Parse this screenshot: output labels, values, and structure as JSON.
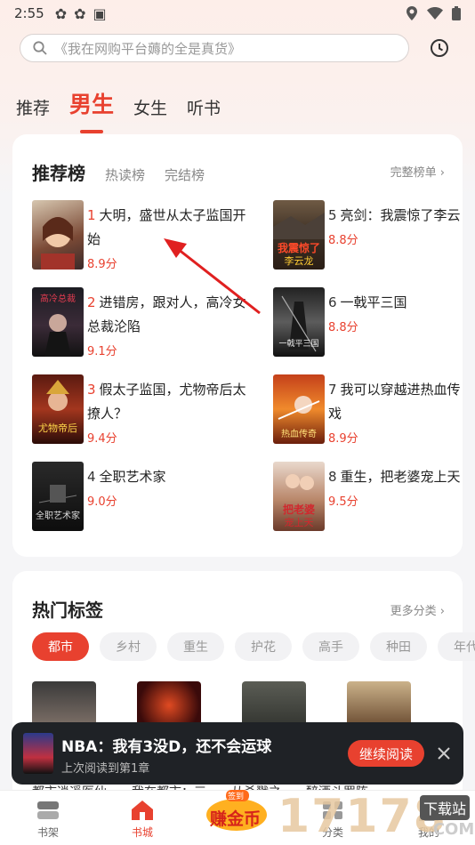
{
  "status_bar": {
    "time": "2:55"
  },
  "search": {
    "placeholder": "《我在网购平台薅的全是真货》"
  },
  "channel_tabs": [
    {
      "label": "推荐",
      "active": false
    },
    {
      "label": "男生",
      "active": true
    },
    {
      "label": "女生",
      "active": false
    },
    {
      "label": "听书",
      "active": false
    }
  ],
  "ranking": {
    "tabs": [
      "推荐榜",
      "热读榜",
      "完结榜"
    ],
    "more": "完整榜单",
    "books": [
      {
        "rank": "1",
        "title": "大明，盛世从太子监国开始",
        "score": "8.9分"
      },
      {
        "rank": "2",
        "title": "进错房，跟对人，高冷女总裁沦陷",
        "score": "9.1分"
      },
      {
        "rank": "3",
        "title": "假太子监国，尤物帝后太撩人？",
        "score": "9.4分"
      },
      {
        "rank": "4",
        "title": "全职艺术家",
        "score": "9.0分"
      },
      {
        "rank": "5",
        "title": "亮剑：我震惊了李云",
        "score": "8.8分"
      },
      {
        "rank": "6",
        "title": "一戟平三国",
        "score": "8.8分"
      },
      {
        "rank": "7",
        "title": "我可以穿越进热血传戏",
        "score": "8.9分"
      },
      {
        "rank": "8",
        "title": "重生，把老婆宠上天",
        "score": "9.5分"
      }
    ]
  },
  "hot_tags": {
    "title": "热门标签",
    "more": "更多分类",
    "chips": [
      "都市",
      "乡村",
      "重生",
      "护花",
      "高手",
      "种田",
      "年代"
    ],
    "book_titles": [
      "都市逍遥医仙",
      "我在都市：三",
      "从杀戮之",
      "醉酒斗罗阵"
    ]
  },
  "mini_player": {
    "title": "NBA：我有3没D，还不会运球",
    "subtitle": "上次阅读到第1章",
    "continue": "继续阅读"
  },
  "bottom_nav": [
    {
      "label": "书架",
      "active": false
    },
    {
      "label": "书城",
      "active": true
    },
    {
      "label": "分类",
      "active": false
    },
    {
      "label": "我的",
      "active": false
    }
  ],
  "earn_badge": {
    "top": "签到",
    "main": "赚金币"
  },
  "watermark": {
    "brand": "17178",
    "tag": "下载站",
    "domain": ".COM"
  },
  "colors": {
    "accent": "#e8412f",
    "mini_bg": "#1f2226"
  }
}
